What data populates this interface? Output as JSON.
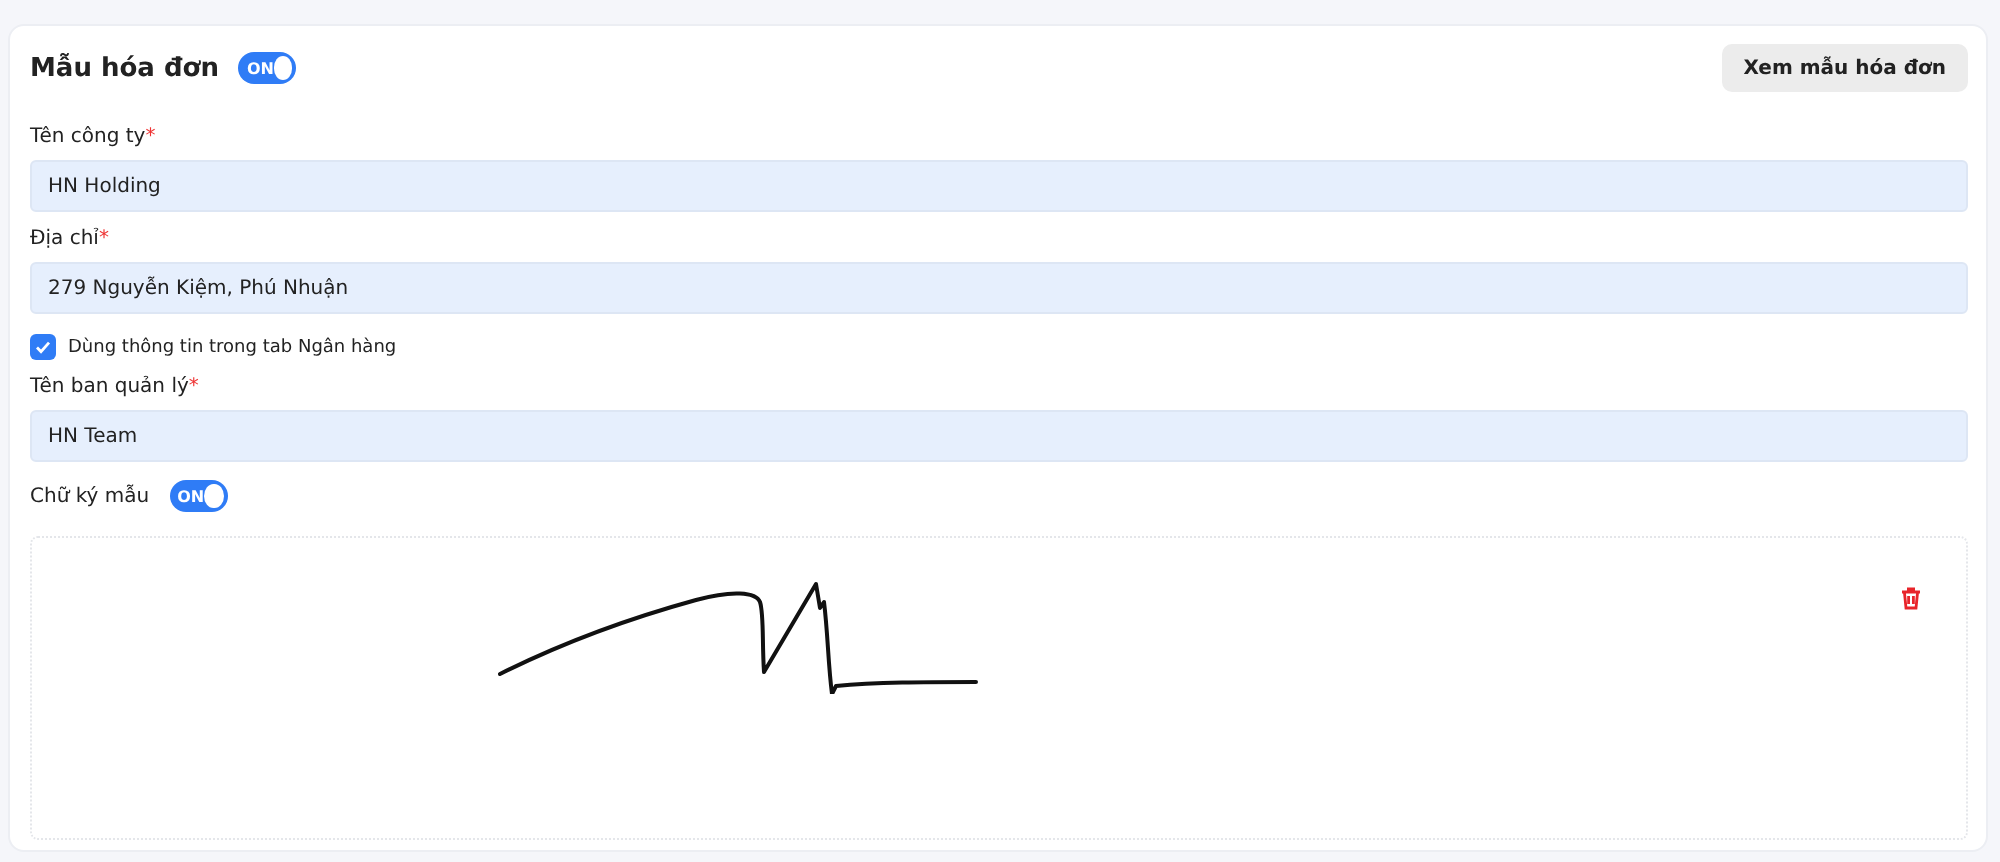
{
  "title": "Mẫu hóa đơn",
  "invoice_toggle": {
    "label": "ON",
    "on": true
  },
  "preview_button": "Xem mẫu hóa đơn",
  "fields": [
    {
      "kind": "input",
      "label": "Tên công ty",
      "required_mark": "*",
      "value": "HN Holding"
    },
    {
      "kind": "input",
      "label": "Địa chỉ",
      "required_mark": "*",
      "value": "279 Nguyễn Kiệm, Phú Nhuận"
    },
    {
      "kind": "checkbox",
      "label": "Dùng thông tin trong tab Ngân hàng",
      "checked": true
    },
    {
      "kind": "input",
      "label": "Tên ban quản lý",
      "required_mark": "*",
      "value": "HN Team"
    }
  ],
  "signature": {
    "label": "Chữ ký mẫu",
    "toggle": {
      "label": "ON",
      "on": true
    }
  }
}
